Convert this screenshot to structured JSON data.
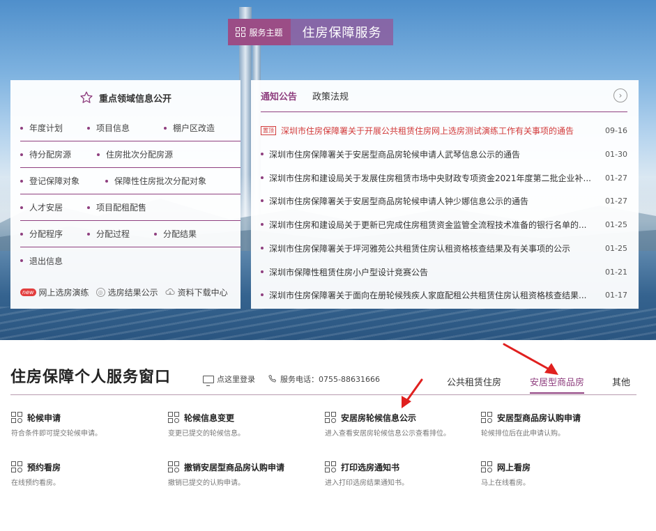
{
  "theme": {
    "tag": "服务主题",
    "title": "住房保障服务"
  },
  "left_panel": {
    "title": "重点领域信息公开",
    "rows": [
      [
        "年度计划",
        "项目信息",
        "棚户区改造"
      ],
      [
        "待分配房源",
        "住房批次分配房源"
      ],
      [
        "登记保障对象",
        "保障性住房批次分配对象"
      ],
      [
        "人才安居",
        "项目配租配售"
      ],
      [
        "分配程序",
        "分配过程",
        "分配结果"
      ],
      [
        "退出信息"
      ]
    ],
    "bottom": {
      "new_badge": "new",
      "b1": "网上选房演练",
      "b2": "选房结果公示",
      "b3": "资料下载中心"
    }
  },
  "right_panel": {
    "tabs": [
      "通知公告",
      "政策法规"
    ],
    "top_badge": "置顶",
    "news": [
      {
        "title": "深圳市住房保障署关于开展公共租赁住房网上选房测试演练工作有关事项的通告",
        "date": "09-16"
      },
      {
        "title": "深圳市住房保障署关于安居型商品房轮候申请人武琴信息公示的通告",
        "date": "01-30"
      },
      {
        "title": "深圳市住房和建设局关于发展住房租赁市场中央财政专项资金2021年度第二批企业补...",
        "date": "01-27"
      },
      {
        "title": "深圳市住房保障署关于安居型商品房轮候申请人钟少娜信息公示的通告",
        "date": "01-27"
      },
      {
        "title": "深圳市住房和建设局关于更新已完成住房租赁资金监管全流程技术准备的银行名单的...",
        "date": "01-25"
      },
      {
        "title": "深圳市住房保障署关于坪河雅苑公共租赁住房认租资格核查结果及有关事项的公示",
        "date": "01-25"
      },
      {
        "title": "深圳市保障性租赁住房小户型设计竞赛公告",
        "date": "01-21"
      },
      {
        "title": "深圳市住房保障署关于面向在册轮候残疾人家庭配租公共租赁住房认租资格核查结果...",
        "date": "01-17"
      }
    ]
  },
  "service": {
    "title": "住房保障个人服务窗口",
    "login": "点这里登录",
    "phone": "服务电话：0755-88631666",
    "tabs": [
      "公共租赁住房",
      "安居型商品房",
      "其他"
    ],
    "items": [
      {
        "h": "轮候申请",
        "d": "符合条件即可提交轮候申请。"
      },
      {
        "h": "轮候信息变更",
        "d": "变更已提交的轮候信息。"
      },
      {
        "h": "安居房轮候信息公示",
        "d": "进入查看安居房轮候信息公示查看排位。"
      },
      {
        "h": "安居型商品房认购申请",
        "d": "轮候排位后在此申请认购。"
      },
      {
        "h": "预约看房",
        "d": "在线预约看房。"
      },
      {
        "h": "撤销安居型商品房认购申请",
        "d": "撤销已提交的认购申请。"
      },
      {
        "h": "打印选房通知书",
        "d": "进入打印选房结果通知书。"
      },
      {
        "h": "网上看房",
        "d": "马上在线看房。"
      }
    ]
  },
  "colors": {
    "accent": "#8f3f7f",
    "highlight_red": "#d23a3a",
    "arrow_red": "#e0201f"
  }
}
